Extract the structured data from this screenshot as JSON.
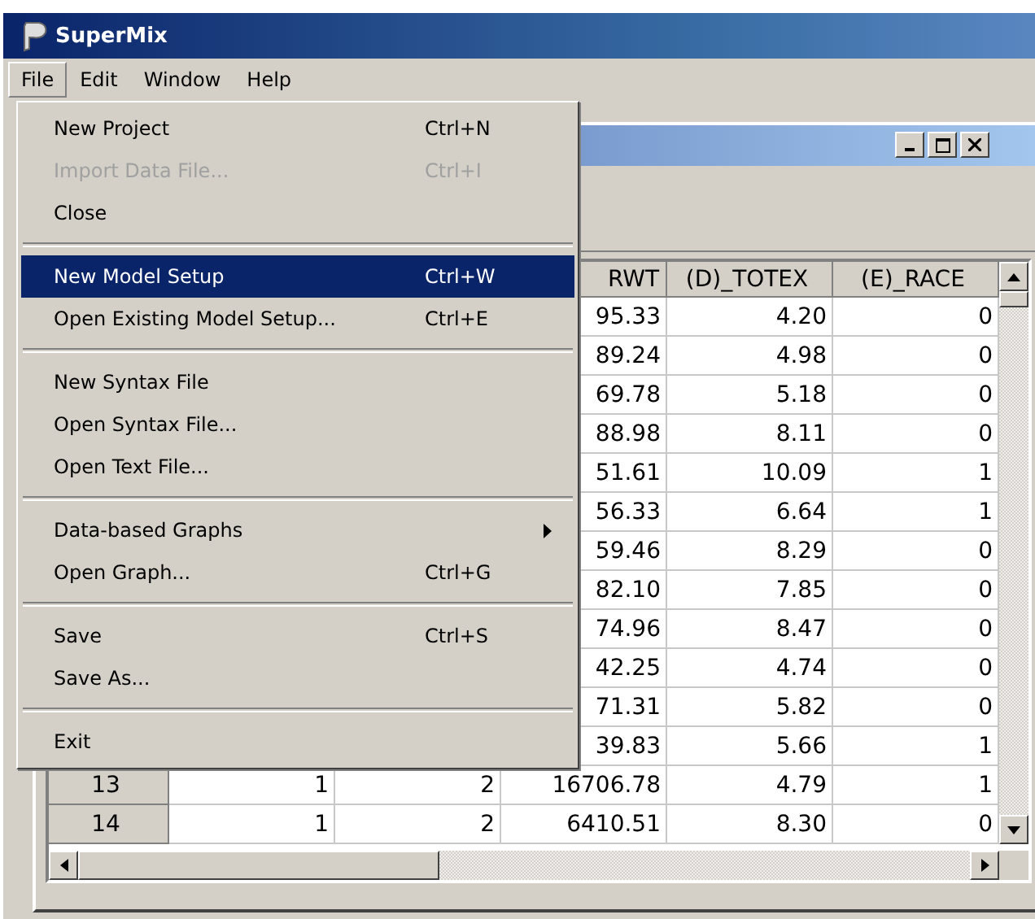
{
  "window": {
    "title": "SuperMix"
  },
  "menubar": [
    {
      "label": "File",
      "selected": true
    },
    {
      "label": "Edit",
      "selected": false
    },
    {
      "label": "Window",
      "selected": false
    },
    {
      "label": "Help",
      "selected": false
    }
  ],
  "file_menu": [
    {
      "kind": "item",
      "label": "New Project",
      "shortcut": "Ctrl+N",
      "disabled": false,
      "selected": false
    },
    {
      "kind": "item",
      "label": "Import Data File...",
      "shortcut": "Ctrl+I",
      "disabled": true,
      "selected": false
    },
    {
      "kind": "item",
      "label": "Close",
      "disabled": false,
      "selected": false
    },
    {
      "kind": "separator"
    },
    {
      "kind": "item",
      "label": "New Model Setup",
      "shortcut": "Ctrl+W",
      "disabled": false,
      "selected": true
    },
    {
      "kind": "item",
      "label": "Open Existing Model Setup...",
      "shortcut": "Ctrl+E",
      "disabled": false,
      "selected": false
    },
    {
      "kind": "separator"
    },
    {
      "kind": "item",
      "label": "New Syntax File",
      "disabled": false,
      "selected": false
    },
    {
      "kind": "item",
      "label": "Open Syntax File...",
      "disabled": false,
      "selected": false
    },
    {
      "kind": "item",
      "label": "Open Text File...",
      "disabled": false,
      "selected": false
    },
    {
      "kind": "separator"
    },
    {
      "kind": "submenu",
      "label": "Data-based Graphs",
      "disabled": false,
      "selected": false
    },
    {
      "kind": "item",
      "label": "Open Graph...",
      "shortcut": "Ctrl+G",
      "disabled": false,
      "selected": false
    },
    {
      "kind": "separator"
    },
    {
      "kind": "item",
      "label": "Save",
      "shortcut": "Ctrl+S",
      "disabled": false,
      "selected": false
    },
    {
      "kind": "item",
      "label": "Save As...",
      "disabled": false,
      "selected": false
    },
    {
      "kind": "separator"
    },
    {
      "kind": "item",
      "label": "Exit",
      "disabled": false,
      "selected": false
    }
  ],
  "data_grid": {
    "columns": [
      "RWT",
      "(D)_TOTEX",
      "(E)_RACE"
    ],
    "rows": [
      {
        "cells": [
          "95.33",
          "4.20",
          "0"
        ]
      },
      {
        "cells": [
          "89.24",
          "4.98",
          "0"
        ]
      },
      {
        "cells": [
          "69.78",
          "5.18",
          "0"
        ]
      },
      {
        "cells": [
          "88.98",
          "8.11",
          "0"
        ]
      },
      {
        "cells": [
          "51.61",
          "10.09",
          "1"
        ]
      },
      {
        "cells": [
          "56.33",
          "6.64",
          "1"
        ]
      },
      {
        "cells": [
          "59.46",
          "8.29",
          "0"
        ]
      },
      {
        "cells": [
          "82.10",
          "7.85",
          "0"
        ]
      },
      {
        "cells": [
          "74.96",
          "8.47",
          "0"
        ]
      },
      {
        "cells": [
          "42.25",
          "4.74",
          "0"
        ]
      },
      {
        "cells": [
          "71.31",
          "5.82",
          "0"
        ]
      },
      {
        "cells": [
          "39.83",
          "5.66",
          "1"
        ]
      },
      {
        "number": "13",
        "cells": [
          "1",
          "2",
          "16706.78",
          "4.79",
          "1"
        ]
      },
      {
        "number": "14",
        "cells": [
          "1",
          "2",
          "6410.51",
          "8.30",
          "0"
        ]
      }
    ]
  }
}
